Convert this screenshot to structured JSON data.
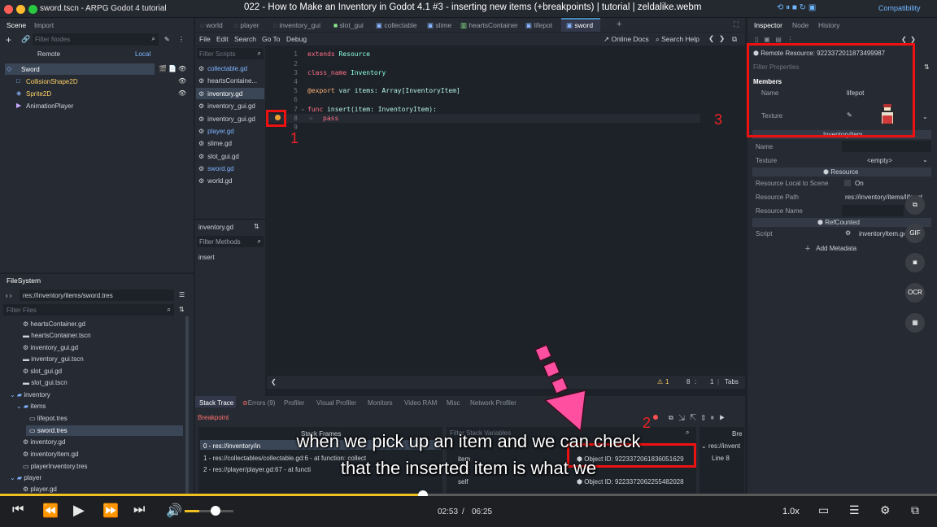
{
  "window": {
    "title": "sword.tscn - ARPG Godot 4 tutorial",
    "video_title": "022 - How to Make an Inventory in Godot 4.1 #3 - inserting new items (+breakpoints) | tutorial | zeldalike.webm",
    "compatibility": "Compatibility"
  },
  "scene_dock": {
    "tabs": [
      "Scene",
      "Import"
    ],
    "filter_placeholder": "Filter Nodes",
    "remote_label": "Remote",
    "local_label": "Local",
    "nodes": [
      "Sword",
      "CollisionShape2D",
      "Sprite2D",
      "AnimationPlayer"
    ]
  },
  "filesystem": {
    "title": "FileSystem",
    "path": "res://inventory/items/sword.tres",
    "filter_placeholder": "Filter Files",
    "items": [
      "heartsContainer.gd",
      "heartsContainer.tscn",
      "inventory_gui.gd",
      "inventory_gui.tscn",
      "slot_gui.gd",
      "slot_gui.tscn",
      "inventory",
      "items",
      "lifepot.tres",
      "sword.tres",
      "inventory.gd",
      "inventoryItem.gd",
      "playerInventory.tres",
      "player",
      "player.gd"
    ]
  },
  "editor_tabs": [
    "world",
    "player",
    "inventory_gui",
    "slot_gui",
    "collectable",
    "slime",
    "heartsContainer",
    "lifepot",
    "sword"
  ],
  "script_menu": {
    "items": [
      "File",
      "Edit",
      "Search",
      "Go To",
      "Debug"
    ],
    "online_docs": "Online Docs",
    "search_help": "Search Help"
  },
  "script_list": {
    "filter_placeholder": "Filter Scripts",
    "scripts": [
      "collectable.gd",
      "heartsContaine...",
      "inventory.gd",
      "inventory_gui.gd",
      "inventory_gui.gd",
      "player.gd",
      "slime.gd",
      "slot_gui.gd",
      "sword.gd",
      "world.gd"
    ],
    "current": "inventory.gd",
    "filter_methods": "Filter Methods",
    "methods": [
      "insert"
    ]
  },
  "code": {
    "line_numbers": [
      "1",
      "2",
      "3",
      "4",
      "5",
      "6",
      "7",
      "8",
      "9"
    ],
    "lines": [
      {
        "a": "extends",
        "b": " Resource"
      },
      {
        "a": "",
        "b": ""
      },
      {
        "a": "class_name",
        "b": " Inventory"
      },
      {
        "a": "",
        "b": ""
      },
      {
        "a": "@export",
        "b": " var items: Array[InventoryItem]"
      },
      {
        "a": "",
        "b": ""
      },
      {
        "a": "func",
        "b": " insert(item: InventoryItem):"
      },
      {
        "a": "",
        "b": "pass"
      },
      {
        "a": "",
        "b": ""
      }
    ],
    "status_warnings": "1",
    "status_line": "8",
    "status_col": "1",
    "status_indent": "Tabs"
  },
  "bottom_panel": {
    "tabs": [
      "Stack Trace",
      "Errors (9)",
      "Profiler",
      "Visual Profiler",
      "Monitors",
      "Video RAM",
      "Misc",
      "Network Profiler"
    ],
    "status": "Breakpoint",
    "stack_frames_header": "Stack Frames",
    "frames": [
      "0 - res://inventory/in",
      "1 - res://collectables/collectable.gd:6 - at function: collect",
      "2 - res://player/player.gd:67 - at functi"
    ],
    "filter_vars_placeholder": "Filter Stack Variables",
    "vars": [
      {
        "name": "item",
        "value": "Object ID: 9223372061836051629"
      },
      {
        "name": "self",
        "value": "Object ID: 9223372062255482028"
      }
    ],
    "breakpoints_header": "Bre",
    "breakpoints": [
      "res://invent",
      "Line 8"
    ]
  },
  "inspector": {
    "tabs": [
      "Inspector",
      "Node",
      "History"
    ],
    "remote_resource": "Remote Resource: 9223372011873499987",
    "filter_placeholder": "Filter Properties",
    "members_header": "Members",
    "member_name_label": "Name",
    "member_name_value": "lifepot",
    "member_texture_label": "Texture",
    "inventory_item_header": "InventoryItem",
    "name_label": "Name",
    "texture_label": "Texture",
    "texture_value": "<empty>",
    "resource_header": "Resource",
    "local_to_scene_label": "Resource Local to Scene",
    "local_to_scene_value": "On",
    "path_label": "Resource Path",
    "path_value": "res://inventory/items/lifepot",
    "resource_name_label": "Resource Name",
    "refcounted_header": "RefCounted",
    "script_label": "Script",
    "script_value": "inventoryItem.gd",
    "add_metadata": "Add Metadata"
  },
  "annotations": {
    "num1": "1",
    "num2": "2",
    "num3": "3"
  },
  "subtitles": {
    "line1": "when we pick up an item and we can check",
    "line2": "that the inserted item is what we"
  },
  "player": {
    "current_time": "02:53",
    "total_time": "06:25",
    "progress": 0.451,
    "volume": 0.3,
    "speed": "1.0x"
  },
  "side_buttons": [
    "GIF",
    "OCR"
  ],
  "colors": {
    "accent": "#478cbf",
    "highlight_red": "#ee1111",
    "progress": "#f0c020"
  }
}
